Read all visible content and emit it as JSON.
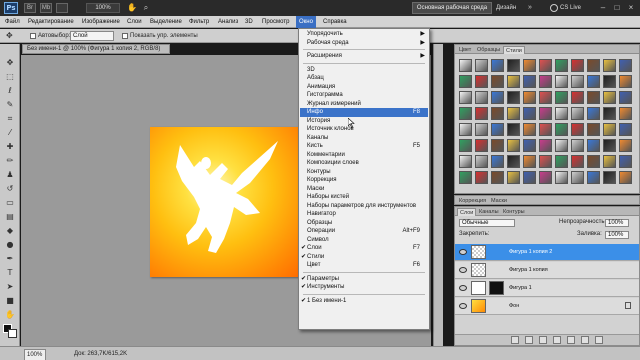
{
  "appbar": {
    "logo": "Ps",
    "zoom": "100%",
    "workspace_main": "Основная рабочая среда",
    "workspace_alt": "Дизайн",
    "cslive": "CS Live"
  },
  "menubar": {
    "items": [
      "Файл",
      "Редактирование",
      "Изображение",
      "Слои",
      "Выделение",
      "Фильтр",
      "Анализ",
      "3D",
      "Просмотр",
      "Окно",
      "Справка"
    ],
    "active": "Окно"
  },
  "options": {
    "autoselect_label": "Автовыбор:",
    "autoselect_value": "Слой",
    "show_controls_label": "Показать упр. элементы"
  },
  "document": {
    "tab_title": "Без имени-1 @ 100% (Фигура 1 копия 2, RGB/8)"
  },
  "window_menu": {
    "items": [
      {
        "label": "Упорядочить",
        "submenu": true
      },
      {
        "label": "Рабочая среда",
        "submenu": true
      },
      {
        "sep": true
      },
      {
        "label": "Расширения",
        "submenu": true
      },
      {
        "sep": true
      },
      {
        "label": "3D"
      },
      {
        "label": "Абзац"
      },
      {
        "label": "Анимация"
      },
      {
        "label": "Гистограмма"
      },
      {
        "label": "Журнал измерений"
      },
      {
        "label": "Инфо",
        "shortcut": "F8",
        "highlighted": true
      },
      {
        "label": "История"
      },
      {
        "label": "Источник клонов"
      },
      {
        "label": "Каналы"
      },
      {
        "label": "Кисть",
        "shortcut": "F5"
      },
      {
        "label": "Комментарии"
      },
      {
        "label": "Композиции слоев"
      },
      {
        "label": "Контуры"
      },
      {
        "label": "Коррекция"
      },
      {
        "label": "Маски"
      },
      {
        "label": "Наборы кистей"
      },
      {
        "label": "Наборы параметров для инструментов"
      },
      {
        "label": "Навигатор"
      },
      {
        "label": "Образцы"
      },
      {
        "label": "Операции",
        "shortcut": "Alt+F9"
      },
      {
        "label": "Символ"
      },
      {
        "label": "Слои",
        "shortcut": "F7",
        "checked": true
      },
      {
        "label": "Стили",
        "checked": true
      },
      {
        "label": "Цвет",
        "shortcut": "F6"
      },
      {
        "sep": true
      },
      {
        "label": "Параметры",
        "checked": true
      },
      {
        "label": "Инструменты",
        "checked": true
      },
      {
        "sep": true
      },
      {
        "label": "1 Без имени-1",
        "checked": true
      }
    ]
  },
  "styles_panel": {
    "tabs": [
      "Цвет",
      "Образцы",
      "Стили"
    ],
    "active_tab": "Стили"
  },
  "adjust_panel": {
    "tabs": [
      "Коррекция",
      "Маски"
    ]
  },
  "layers_panel": {
    "tabs": [
      "Слои",
      "Каналы",
      "Контуры"
    ],
    "blend_mode": "Обычные",
    "opacity_label": "Непрозрачность:",
    "opacity_value": "100%",
    "lock_label": "Закрепить:",
    "fill_label": "Заливка:",
    "fill_value": "100%",
    "layers": [
      {
        "name": "Фигура 1 копия 2",
        "selected": true
      },
      {
        "name": "Фигура 1 копия",
        "selected": false
      },
      {
        "name": "Фигура 1",
        "selected": false
      },
      {
        "name": "Фон",
        "selected": false
      }
    ]
  },
  "status": {
    "zoom": "100%",
    "doc": "Док: 263,7K/615,2K"
  },
  "colors": {
    "menu_highlight": "#3b73c9",
    "layer_selected": "#3b8fe8",
    "canvas_orange": "#ff8a05",
    "canvas_yellow": "#ffe040"
  }
}
